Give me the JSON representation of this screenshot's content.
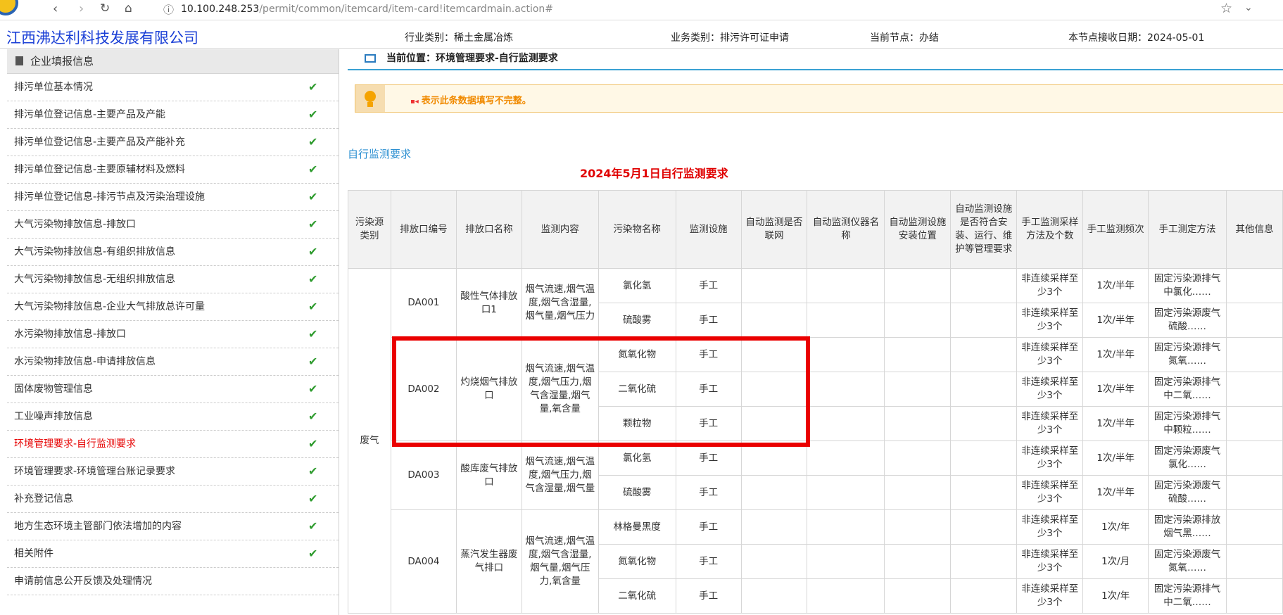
{
  "browser": {
    "url_host": "10.100.248.253",
    "url_path": "/permit/common/itemcard/item-card!itemcardmain.action#"
  },
  "header": {
    "company": "江西沸达利科技发展有限公司",
    "industry": "行业类别：稀土金属冶炼",
    "business": "业务类别：排污许可证申请",
    "node": "当前节点：办结",
    "date": "本节点接收日期：2024-05-01"
  },
  "sidebar": {
    "title": "企业填报信息",
    "items": [
      {
        "label": "排污单位基本情况",
        "done": true
      },
      {
        "label": "排污单位登记信息-主要产品及产能",
        "done": true
      },
      {
        "label": "排污单位登记信息-主要产品及产能补充",
        "done": true
      },
      {
        "label": "排污单位登记信息-主要原辅材料及燃料",
        "done": true
      },
      {
        "label": "排污单位登记信息-排污节点及污染治理设施",
        "done": true
      },
      {
        "label": "大气污染物排放信息-排放口",
        "done": true
      },
      {
        "label": "大气污染物排放信息-有组织排放信息",
        "done": true
      },
      {
        "label": "大气污染物排放信息-无组织排放信息",
        "done": true
      },
      {
        "label": "大气污染物排放信息-企业大气排放总许可量",
        "done": true
      },
      {
        "label": "水污染物排放信息-排放口",
        "done": true
      },
      {
        "label": "水污染物排放信息-申请排放信息",
        "done": true
      },
      {
        "label": "固体废物管理信息",
        "done": true
      },
      {
        "label": "工业噪声排放信息",
        "done": true
      },
      {
        "label": "环境管理要求-自行监测要求",
        "done": true,
        "active": true
      },
      {
        "label": "环境管理要求-环境管理台账记录要求",
        "done": true
      },
      {
        "label": "补充登记信息",
        "done": true
      },
      {
        "label": "地方生态环境主管部门依法增加的内容",
        "done": true
      },
      {
        "label": "相关附件",
        "done": true
      },
      {
        "label": "申请前信息公开反馈及处理情况",
        "done": false
      }
    ]
  },
  "main": {
    "breadcrumb": "当前位置：环境管理要求-自行监测要求",
    "notice_marker": "▪◂",
    "notice": "表示此条数据填写不完整。",
    "section_title": "自行监测要求",
    "table_title": "2024年5月1日自行监测要求",
    "columns": [
      "污染源类别",
      "排放口编号",
      "排放口名称",
      "监测内容",
      "污染物名称",
      "监测设施",
      "自动监测是否联网",
      "自动监测仪器名称",
      "自动监测设施安装位置",
      "自动监测设施是否符合安装、运行、维护等管理要求",
      "手工监测采样方法及个数",
      "手工监测频次",
      "手工测定方法",
      "其他信息"
    ],
    "source_type": "废气",
    "outlets": [
      {
        "code": "DA001",
        "name": "酸性气体排放口1",
        "content": "烟气流速,烟气温度,烟气含湿量,烟气量,烟气压力",
        "rows": [
          {
            "pollutant": "氯化氢",
            "facility": "手工",
            "method": "非连续采样至少3个",
            "freq": "1次/半年",
            "measure": "固定污染源排气中氯化……"
          },
          {
            "pollutant": "硫酸雾",
            "facility": "手工",
            "method": "非连续采样至少3个",
            "freq": "1次/半年",
            "measure": "固定污染源废气硫酸……"
          }
        ]
      },
      {
        "code": "DA002",
        "name": "灼烧烟气排放口",
        "content": "烟气流速,烟气温度,烟气压力,烟气含湿量,烟气量,氧含量",
        "rows": [
          {
            "pollutant": "氮氧化物",
            "facility": "手工",
            "method": "非连续采样至少3个",
            "freq": "1次/半年",
            "measure": "固定污染源排气氮氧……"
          },
          {
            "pollutant": "二氧化硫",
            "facility": "手工",
            "method": "非连续采样至少3个",
            "freq": "1次/半年",
            "measure": "固定污染源排气中二氧……"
          },
          {
            "pollutant": "颗粒物",
            "facility": "手工",
            "method": "非连续采样至少3个",
            "freq": "1次/半年",
            "measure": "固定污染源排气中颗粒……"
          }
        ]
      },
      {
        "code": "DA003",
        "name": "酸库废气排放口",
        "content": "烟气流速,烟气温度,烟气压力,烟气含湿量,烟气量",
        "rows": [
          {
            "pollutant": "氯化氢",
            "facility": "手工",
            "method": "非连续采样至少3个",
            "freq": "1次/半年",
            "measure": "固定污染源废气氯化……"
          },
          {
            "pollutant": "硫酸雾",
            "facility": "手工",
            "method": "非连续采样至少3个",
            "freq": "1次/半年",
            "measure": "固定污染源废气硫酸……"
          }
        ]
      },
      {
        "code": "DA004",
        "name": "蒸汽发生器废气排口",
        "content": "烟气流速,烟气温度,烟气含湿量,烟气量,烟气压力,氧含量",
        "rows": [
          {
            "pollutant": "林格曼黑度",
            "facility": "手工",
            "method": "非连续采样至少3个",
            "freq": "1次/年",
            "measure": "固定污染源排放烟气黑……"
          },
          {
            "pollutant": "氮氧化物",
            "facility": "手工",
            "method": "非连续采样至少3个",
            "freq": "1次/月",
            "measure": "固定污染源废气氮氧……"
          },
          {
            "pollutant": "二氧化硫",
            "facility": "手工",
            "method": "非连续采样至少3个",
            "freq": "1次/年",
            "measure": "固定污染源排气中二氧……"
          }
        ]
      }
    ]
  },
  "colors": {
    "accent": "#3aa1d3",
    "active": "#e60000",
    "check": "#2e9b2e",
    "highlight": "#ea0000"
  }
}
